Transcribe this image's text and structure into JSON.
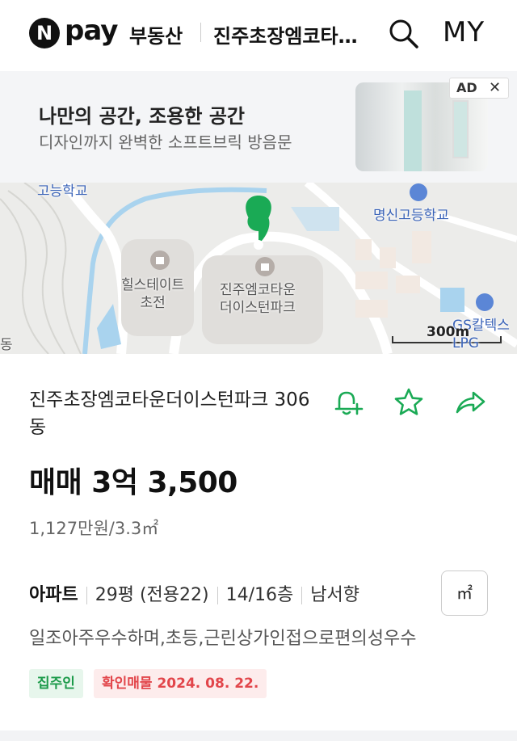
{
  "header": {
    "logo_letter": "N",
    "logo_pay": "pay",
    "logo_service": "부동산",
    "title": "진주초장엠코타운더이스턴파크",
    "my_label": "MY",
    "icons": {
      "search": "search-icon"
    }
  },
  "ad": {
    "title": "나만의 공간, 조용한 공간",
    "subtitle": "디자인까지 완벽한 소프트브릭 방음문",
    "badge": "AD",
    "close": "✕"
  },
  "map": {
    "labels": {
      "school_top": "고능학교",
      "school_right": "명신고등학교",
      "hill": "힐스테이트\n초전",
      "target": "진주엠코타운\n더이스턴파크",
      "gas": "GS칼텍스\nLPG",
      "dong": "동"
    },
    "scale": "300m",
    "colors": {
      "pin": "#1aaa55",
      "water": "#a9d3ee",
      "road": "#ffffff",
      "block": "#e0dedb"
    }
  },
  "listing": {
    "name": "진주초장엠코타운더이스턴파크 306동",
    "price": "매매 3억 3,500",
    "unit_price": "1,127만원/3.3㎡",
    "property_type": "아파트",
    "area": "29평 (전용22)",
    "floor": "14/16층",
    "direction": "남서향",
    "unit_toggle": "㎡",
    "description": "일조아주우수하며,초등,근린상가인접으로편의성우수",
    "tags": {
      "owner": "집주인",
      "confirmed": "확인매물 2024. 08. 22."
    },
    "actions": {
      "alert": "bell-plus-icon",
      "favorite": "star-icon",
      "share": "share-icon"
    },
    "colors": {
      "accent": "#1aaa55",
      "confirm": "#e2464b"
    }
  }
}
